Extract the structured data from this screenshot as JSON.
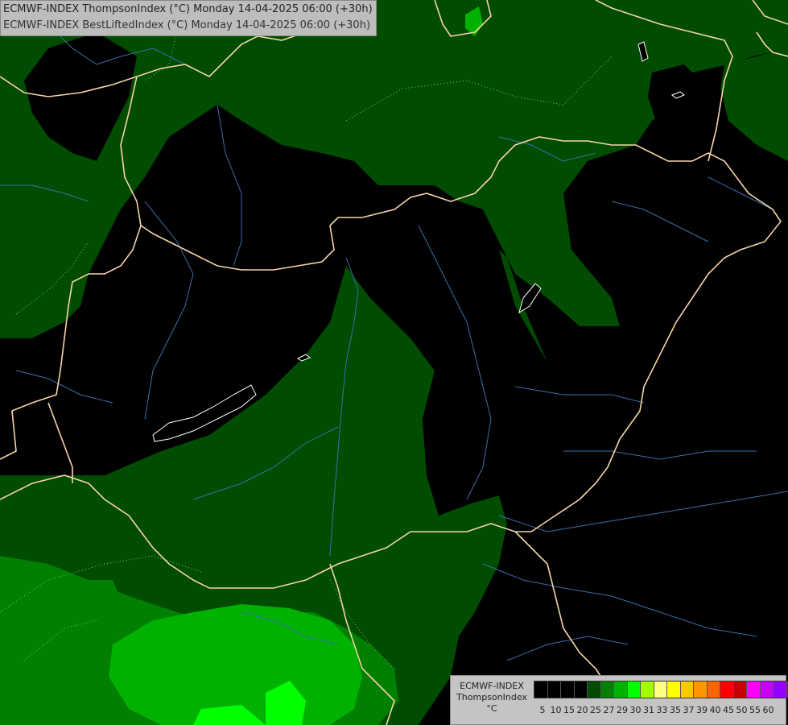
{
  "header": {
    "line1": "ECMWF-INDEX ThompsonIndex (°C) Monday 14-04-2025 06:00 (+30h)",
    "line2": "ECMWF-INDEX BestLiftedIndex (°C) Monday 14-04-2025 06:00 (+30h)"
  },
  "legend": {
    "model": "ECMWF-INDEX",
    "parameter": "ThompsonIndex",
    "unit": "°C",
    "colors": [
      "#000000",
      "#000000",
      "#000000",
      "#000000",
      "#004c00",
      "#007f00",
      "#00b200",
      "#00ff00",
      "#a0ff00",
      "#ffff80",
      "#ffff00",
      "#ffc800",
      "#ff9600",
      "#ff6400",
      "#ff0000",
      "#c80000",
      "#ff00ff",
      "#c800ff",
      "#9600ff",
      "#6400ff",
      "#0000ff"
    ],
    "ticks": [
      "5",
      "10",
      "15",
      "20",
      "25",
      "27",
      "29",
      "30",
      "31",
      "33",
      "35",
      "37",
      "39",
      "40",
      "45",
      "50",
      "55",
      "60"
    ]
  },
  "palette": {
    "background": "#000000",
    "level_dark_green": "#004c00",
    "level_mid_green": "#007f00",
    "level_green": "#00b200",
    "level_bright_green": "#00ff00",
    "border_color": "#f5d5a8",
    "river_color": "#3c6ea8",
    "lake_color": "#ffffff"
  }
}
